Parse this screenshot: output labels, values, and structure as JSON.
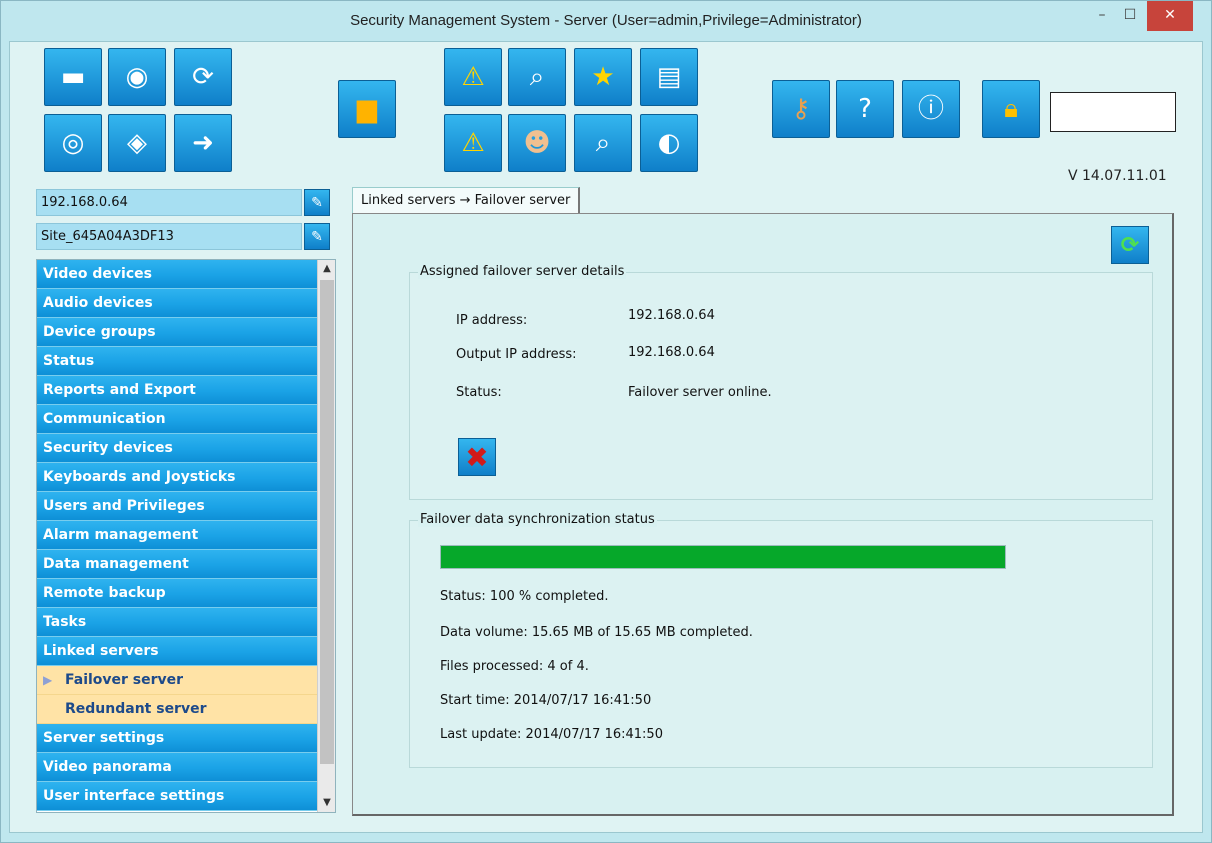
{
  "window": {
    "title": "Security Management System - Server (User=admin,Privilege=Administrator)",
    "minimize": "–",
    "maximize": "☐",
    "close": "✕"
  },
  "version": "V 14.07.11.01",
  "fields": {
    "ip": "192.168.0.64",
    "site": "Site_645A04A3DF13"
  },
  "nav": {
    "items": [
      {
        "label": "Video devices"
      },
      {
        "label": "Audio devices"
      },
      {
        "label": "Device groups"
      },
      {
        "label": "Status"
      },
      {
        "label": "Reports and Export"
      },
      {
        "label": "Communication"
      },
      {
        "label": "Security devices"
      },
      {
        "label": "Keyboards and Joysticks"
      },
      {
        "label": "Users and Privileges"
      },
      {
        "label": "Alarm management"
      },
      {
        "label": "Data management"
      },
      {
        "label": "Remote backup"
      },
      {
        "label": "Tasks"
      },
      {
        "label": "Linked servers"
      }
    ],
    "sub_items": [
      {
        "label": "Failover server",
        "selected": true
      },
      {
        "label": "Redundant server",
        "selected": false
      }
    ],
    "items_after": [
      {
        "label": "Server settings"
      },
      {
        "label": "Video panorama"
      },
      {
        "label": "User interface settings"
      }
    ]
  },
  "tab": {
    "label": "Linked servers → Failover server"
  },
  "assigned": {
    "title": "Assigned failover server details",
    "ip_label": "IP address:",
    "ip_value": "192.168.0.64",
    "output_ip_label": "Output IP address:",
    "output_ip_value": "192.168.0.64",
    "status_label": "Status:",
    "status_value": "Failover server online."
  },
  "sync": {
    "title": "Failover data synchronization status",
    "progress_percent": 100,
    "status": "Status: 100 % completed.",
    "volume": "Data volume: 15.65 MB of 15.65 MB completed.",
    "files": "Files processed: 4 of 4.",
    "start": "Start time: 2014/07/17 16:41:50",
    "last": "Last update: 2014/07/17 16:41:50"
  },
  "toolbar_icons": [
    "camera-icon",
    "globe-icon",
    "film-refresh-icon",
    "film-icon",
    "eye-icon",
    "film-export-icon",
    "windows-icon",
    "warning-icon",
    "search-icon",
    "film-star-icon",
    "report-icon",
    "warning-flash-icon",
    "user-icon",
    "film-search-icon",
    "disc-export-icon",
    "key-icon",
    "help-doc-icon",
    "info-icon",
    "lock-icon"
  ],
  "colors": {
    "nav_blue": "#1aa2e6",
    "sub_selected": "#ffe3a6",
    "progress_green": "#06a82a"
  }
}
